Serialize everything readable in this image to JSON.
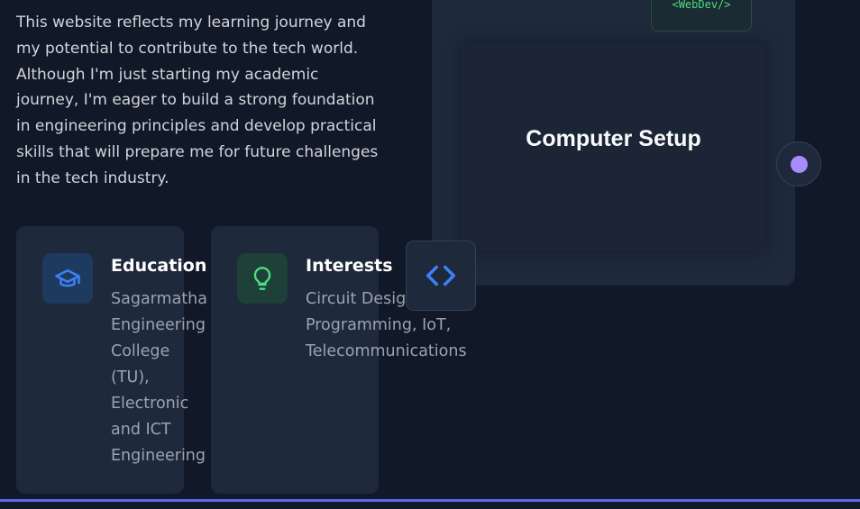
{
  "about": {
    "intro": "This website reflects my learning journey and my potential to contribute to the tech world. Although I'm just starting my academic journey, I'm eager to build a strong foundation in engineering principles and develop practical skills that will prepare me for future challenges in the tech industry."
  },
  "cards": {
    "education": {
      "title": "Education",
      "description": "Sagarmatha Engineering College (TU), Electronic and ICT Engineering",
      "icon": "graduation-cap-icon",
      "accent": "#3b82f6"
    },
    "interests": {
      "title": "Interests",
      "description_lines": [
        "Circuit Design,",
        "Programming, IoT,",
        "Telecommunications"
      ],
      "icon": "lightbulb-icon",
      "accent": "#4ade80"
    }
  },
  "code_chip": {
    "icon": "code-brackets-icon",
    "accent": "#3b82f6"
  },
  "setup": {
    "title": "Computer Setup",
    "tag": "<WebDev/>",
    "tag_color": "#4ade80",
    "dot_color": "#a78bfa"
  },
  "colors": {
    "background": "#111827",
    "card": "#1e293b",
    "bottom_line": "#6366f1"
  }
}
